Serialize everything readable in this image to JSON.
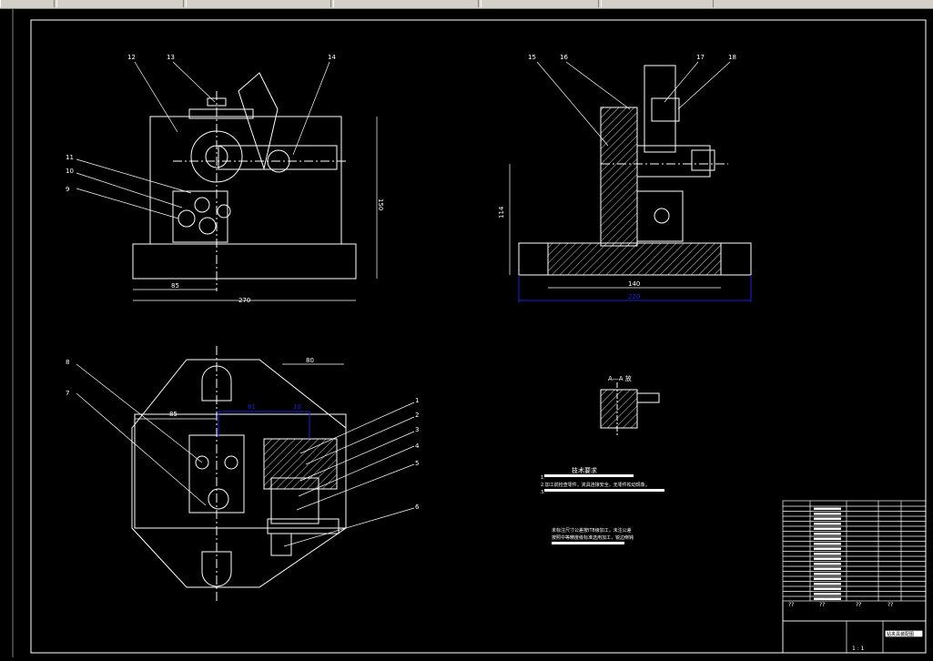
{
  "window": {
    "toolbar_segments": [
      "",
      "",
      "",
      "",
      "",
      ""
    ]
  },
  "front_view": {
    "balloons": [
      "12",
      "13",
      "14",
      "11",
      "10",
      "9"
    ],
    "dim_height": "150",
    "dim_left": "85",
    "dim_total": "270"
  },
  "side_view": {
    "balloons": [
      "15",
      "16",
      "17",
      "18"
    ],
    "dim_height": "114",
    "dim_inner": "140",
    "dim_total": "220"
  },
  "top_view": {
    "balloons_left": [
      "8",
      "7"
    ],
    "balloons_right": [
      "1",
      "2",
      "3",
      "4",
      "5",
      "6"
    ],
    "dim_top": "80",
    "dim_left": "85",
    "dim_inner": "61",
    "dim_inner_right": "10"
  },
  "section": {
    "label": "A—A 放"
  },
  "tech_req": {
    "title": "技术要求",
    "items": [
      "1.",
      "2.加工前检查零件，夹具连接安全，无零件松动现象。",
      "3."
    ],
    "note_line1": "未标注尺寸公差按IT8级加工，未注公差",
    "note_line2": "按照中等精度级标准选用加工，锐边倒钝"
  },
  "title_block": {
    "drawing_name": "钻夹具装配图",
    "sheet": "1 : 1",
    "qty_marks": [
      "??",
      "??",
      "??",
      "??"
    ]
  },
  "colors": {
    "background": "#000000",
    "lines": "#ffffff",
    "hatch": "#ffffff",
    "dimension_blue": "#1e1ee6",
    "title_block_border": "#ffffff"
  }
}
